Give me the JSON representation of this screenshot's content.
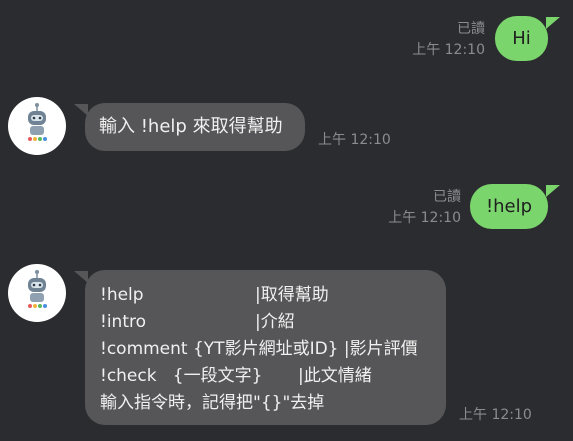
{
  "messages": [
    {
      "direction": "outgoing",
      "text": "Hi",
      "read_label": "已讀",
      "time": "上午 12:10"
    },
    {
      "direction": "incoming",
      "avatar_icon": "robot-icon",
      "text": "輸入 !help 來取得幫助",
      "time": "上午 12:10"
    },
    {
      "direction": "outgoing",
      "text": "!help",
      "read_label": "已讀",
      "time": "上午 12:10"
    },
    {
      "direction": "incoming",
      "avatar_icon": "robot-icon",
      "lines": [
        {
          "cmd": "!help",
          "desc": "|取得幫助"
        },
        {
          "cmd": "!intro",
          "desc": "|介紹"
        },
        {
          "cmd": "!comment {YT影片網址或ID} ",
          "desc": "|影片評價"
        },
        {
          "cmd": "!check   {一段文字}",
          "desc": "|此文情緒"
        },
        {
          "cmd": "輸入指令時，記得把\"{}\"去掉",
          "desc": ""
        }
      ],
      "time": "上午 12:10"
    }
  ],
  "colors": {
    "background": "#2b2c2f",
    "outgoing_bubble": "#7ad56c",
    "incoming_bubble": "#565658",
    "meta_text": "#8a8c90"
  }
}
